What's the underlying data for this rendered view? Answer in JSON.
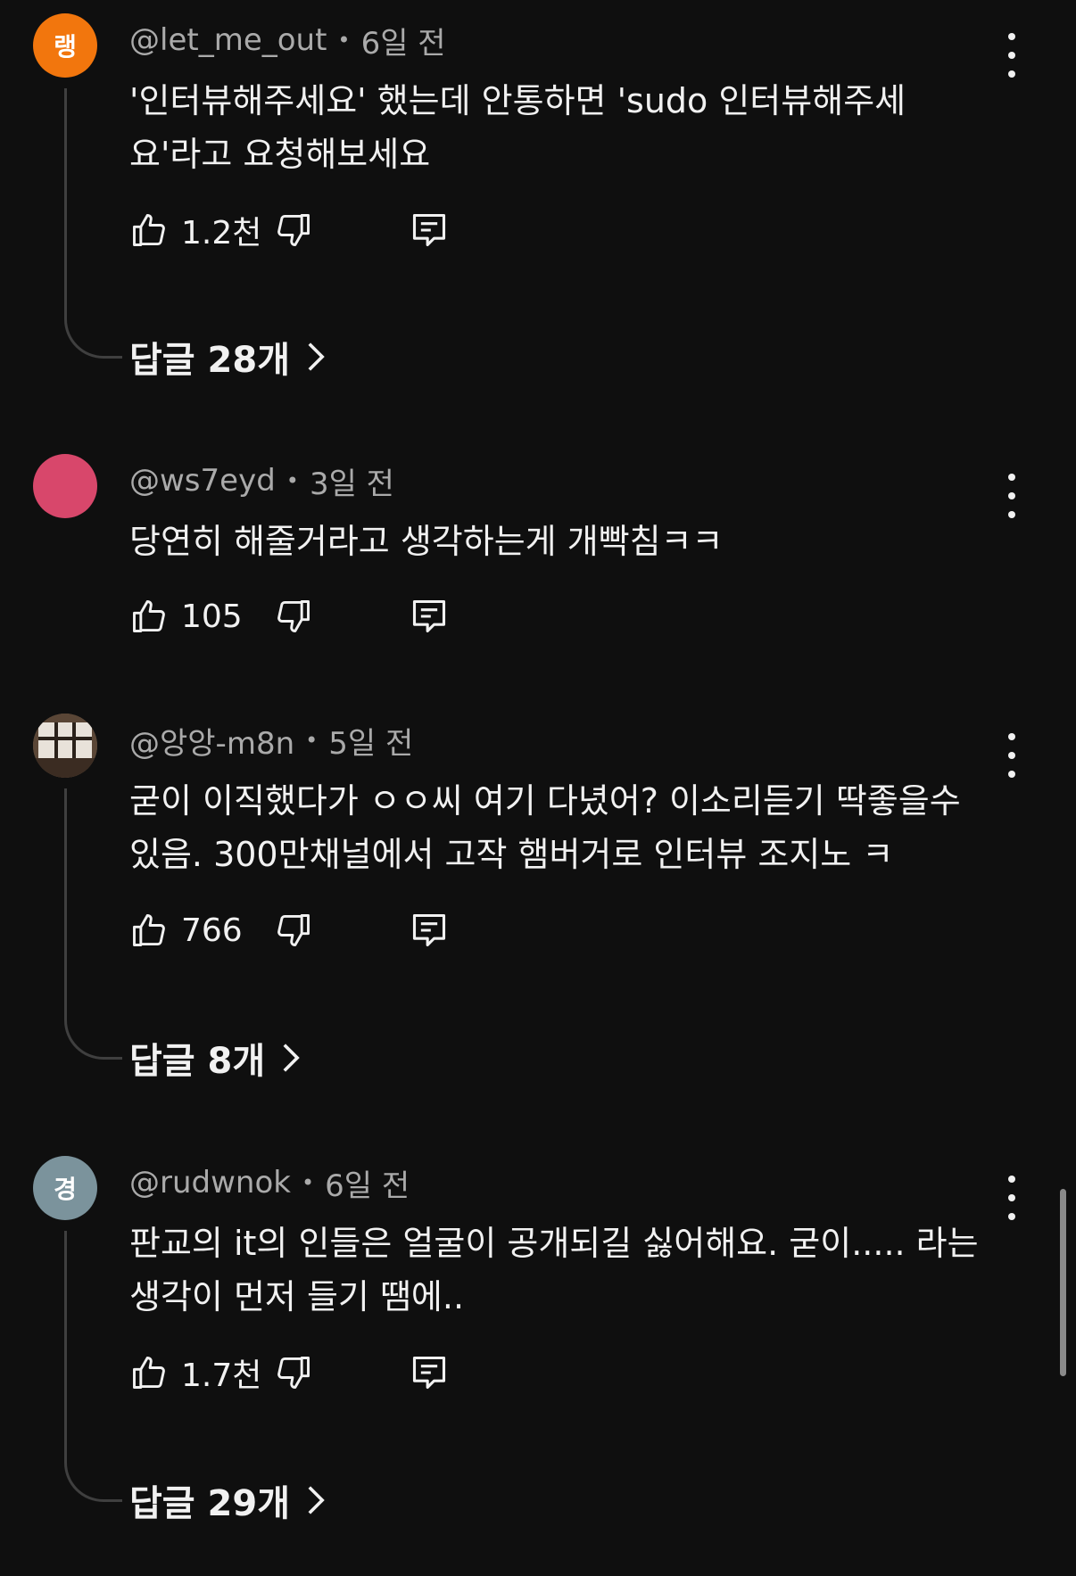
{
  "comments": [
    {
      "avatar_text": "랭",
      "avatar_color": "#f2760d",
      "username": "@let_me_out",
      "time": "6일 전",
      "lines": [
        "'인터뷰해주세요' 했는데 안통하면 'sudo 인터뷰해주세",
        "요'라고 요청해보세요"
      ],
      "likes": "1.2천",
      "replies_label": "답글 28개"
    },
    {
      "avatar_text": "",
      "avatar_color": "#d8476b",
      "username": "@ws7eyd",
      "time": "3일 전",
      "lines": [
        "당연히 해줄거라고 생각하는게 개빡침ㅋㅋ"
      ],
      "likes": "105"
    },
    {
      "avatar_text": "",
      "avatar_color": "#6b5a4a",
      "username": "@앙앙-m8n",
      "time": "5일 전",
      "lines": [
        "굳이 이직했다가 ㅇㅇ씨 여기 다녔어? 이소리듣기 딱좋을수",
        "있음. 300만채널에서 고작 햄버거로 인터뷰 조지노 ㅋ"
      ],
      "likes": "766",
      "replies_label": "답글 8개"
    },
    {
      "avatar_text": "경",
      "avatar_color": "#7b939c",
      "username": "@rudwnok",
      "time": "6일 전",
      "lines": [
        "판교의 it의 인들은 얼굴이 공개되길 싫어해요. 굳이..... 라는",
        "생각이 먼저 들기 땜에.."
      ],
      "likes": "1.7천",
      "replies_label": "답글 29개"
    }
  ],
  "icons": {
    "like": "thumbs-up-icon",
    "dislike": "thumbs-down-icon",
    "reply": "reply-comment-icon",
    "more": "more-vertical-icon",
    "chevron": "chevron-right-icon"
  }
}
